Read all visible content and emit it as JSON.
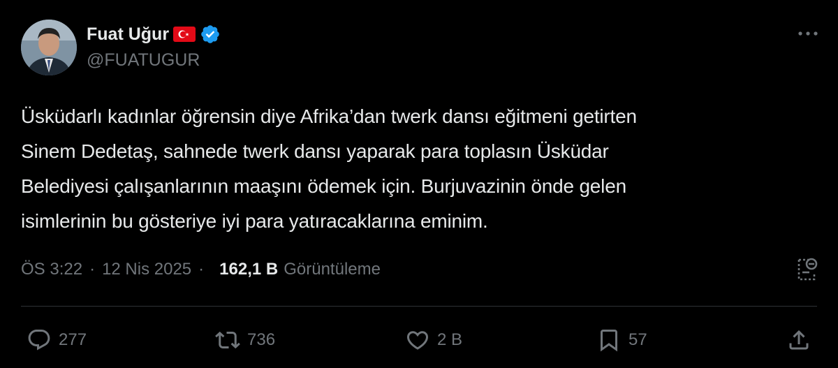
{
  "author": {
    "name": "Fuat Uğur",
    "handle": "@FUATUGUR"
  },
  "tweet": {
    "lines": [
      "Üsküdarlı kadınlar öğrensin diye Afrika’dan twerk dansı eğitmeni getirten",
      "Sinem Dedetaş, sahnede twerk dansı yaparak para toplasın Üsküdar",
      "Belediyesi çalışanlarının maaşını ödemek için. Burjuvazinin önde gelen",
      "isimlerinin bu gösteriye iyi para yatıracaklarına eminim."
    ]
  },
  "meta": {
    "time": "ÖS 3:22",
    "separator": "·",
    "date": "12 Nis 2025",
    "views_count": "162,1 B",
    "views_label": "Görüntüleme"
  },
  "actions": {
    "replies": "277",
    "reposts": "736",
    "likes": "2 B",
    "bookmarks": "57"
  },
  "icons": [
    "avatar",
    "turkey-flag-icon",
    "verified-badge-icon",
    "more-icon",
    "grok-icon",
    "reply-icon",
    "repost-icon",
    "like-icon",
    "bookmark-icon",
    "share-icon"
  ],
  "colors": {
    "background": "#000000",
    "text": "#e7e9ea",
    "muted": "#71767b",
    "verified": "#1d9bf0",
    "flag": "#e30a17"
  }
}
